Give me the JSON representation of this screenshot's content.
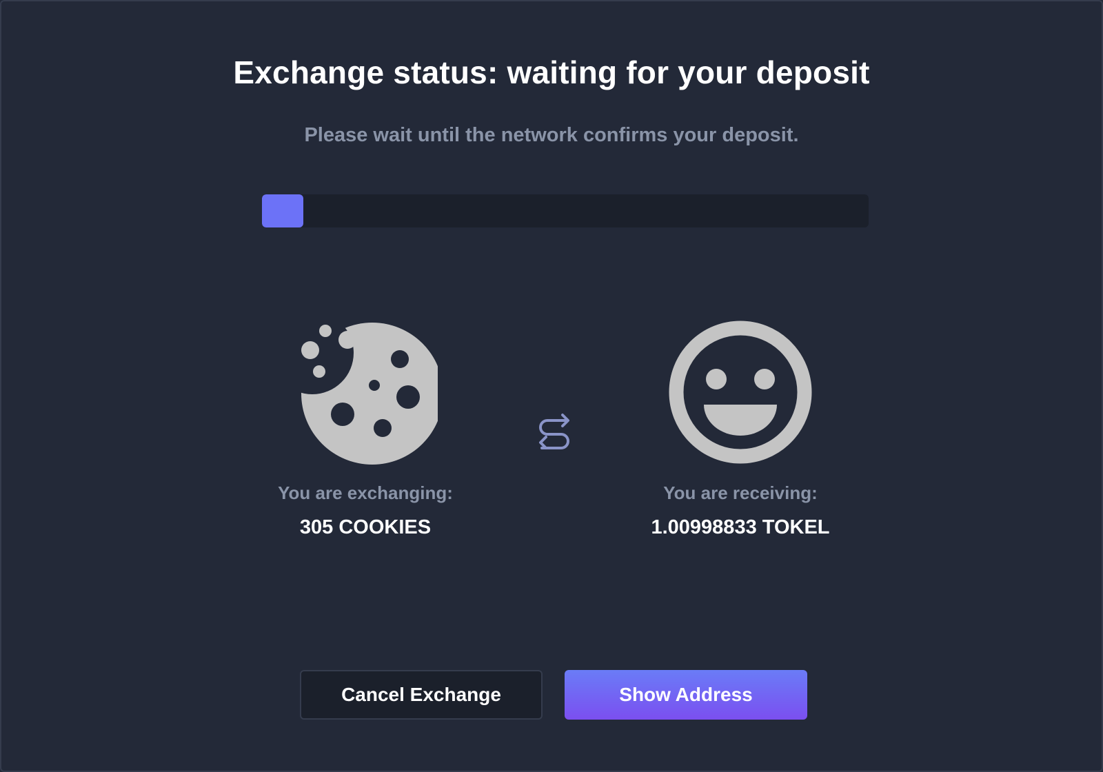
{
  "header": {
    "title": "Exchange status: waiting for your deposit",
    "subtitle": "Please wait until the network confirms your deposit."
  },
  "progress": {
    "fraction": 0.068
  },
  "exchange": {
    "from": {
      "icon": "cookie-icon",
      "caption": "You are exchanging:",
      "amount": "305 COOKIES"
    },
    "swap_icon": "swap-arrows-icon",
    "to": {
      "icon": "smiley-icon",
      "caption": "You are receiving:",
      "amount": "1.00998833 TOKEL"
    }
  },
  "actions": {
    "cancel_label": "Cancel Exchange",
    "show_address_label": "Show Address"
  },
  "colors": {
    "background": "#232938",
    "panel_dark": "#1b202b",
    "accent": "#6c72f7",
    "accent_gradient_start": "#6a7cf7",
    "accent_gradient_end": "#7b4ff0",
    "icon_gray": "#c4c4c4",
    "muted_text": "#8a94a8",
    "swap_icon": "#8a94c8"
  }
}
